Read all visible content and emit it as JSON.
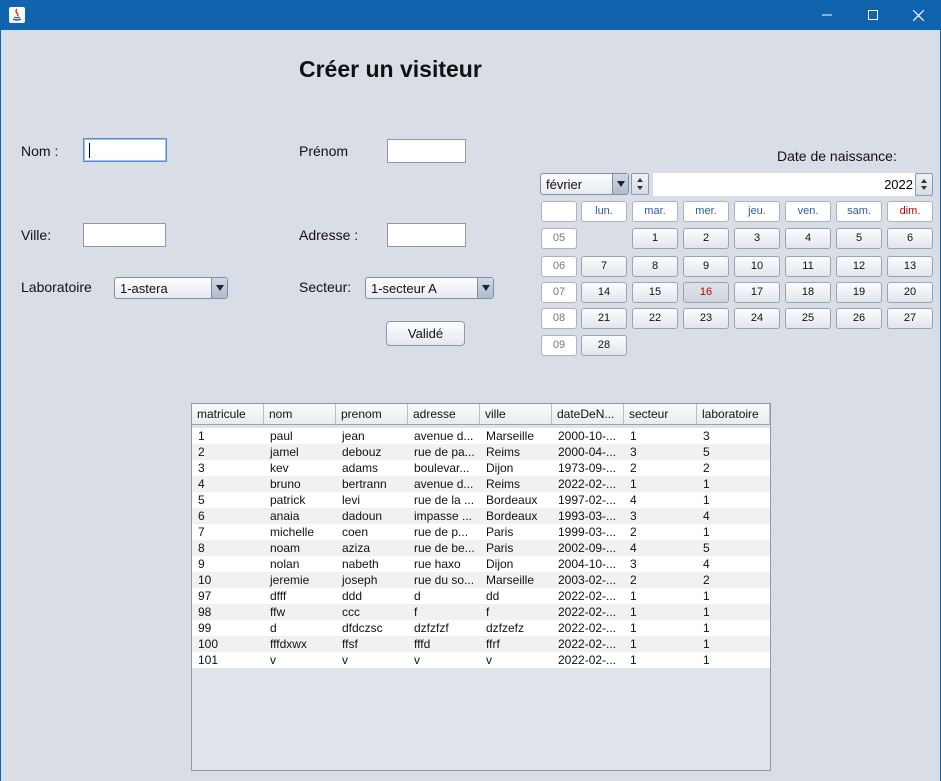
{
  "window": {
    "title": ""
  },
  "form": {
    "title": "Créer un visiteur",
    "nom_label": "Nom :",
    "prenom_label": "Prénom",
    "ville_label": "Ville:",
    "adresse_label": "Adresse :",
    "laboratoire_label": "Laboratoire",
    "laboratoire_value": "1-astera",
    "secteur_label": "Secteur:",
    "secteur_value": "1-secteur A",
    "valider_label": "Validé",
    "nom_value": "",
    "prenom_value": "",
    "ville_value": "",
    "adresse_value": ""
  },
  "calendar": {
    "label": "Date de naissance:",
    "month": "février",
    "year": "2022",
    "day_headers": [
      "lun.",
      "mar.",
      "mer.",
      "jeu.",
      "ven.",
      "sam.",
      "dim."
    ],
    "weeks": [
      {
        "week": "05",
        "days": [
          "",
          "1",
          "2",
          "3",
          "4",
          "5",
          "6"
        ]
      },
      {
        "week": "06",
        "days": [
          "7",
          "8",
          "9",
          "10",
          "11",
          "12",
          "13"
        ]
      },
      {
        "week": "07",
        "days": [
          "14",
          "15",
          "16",
          "17",
          "18",
          "19",
          "20"
        ]
      },
      {
        "week": "08",
        "days": [
          "21",
          "22",
          "23",
          "24",
          "25",
          "26",
          "27"
        ]
      },
      {
        "week": "09",
        "days": [
          "28",
          "",
          "",
          "",
          "",
          "",
          ""
        ]
      }
    ],
    "selected_day": "16",
    "colors": {
      "sunday": "#c00000",
      "selected": "#c00000",
      "header": "#2a5aa0"
    }
  },
  "table": {
    "columns": [
      "matricule",
      "nom",
      "prenom",
      "adresse",
      "ville",
      "dateDeN...",
      "secteur",
      "laboratoire"
    ],
    "rows": [
      [
        "1",
        "paul",
        "jean",
        "avenue d...",
        "Marseille",
        "2000-10-...",
        "1",
        "3"
      ],
      [
        "2",
        "jamel",
        "debouz",
        "rue de pa...",
        "Reims",
        "2000-04-...",
        "3",
        "5"
      ],
      [
        "3",
        "kev",
        "adams",
        "boulevar...",
        "Dijon",
        "1973-09-...",
        "2",
        "2"
      ],
      [
        "4",
        "bruno",
        "bertrann",
        "avenue d...",
        "Reims",
        "2022-02-...",
        "1",
        "1"
      ],
      [
        "5",
        "patrick",
        "levi",
        "rue de la ...",
        "Bordeaux",
        "1997-02-...",
        "4",
        "1"
      ],
      [
        "6",
        "anaia",
        "dadoun",
        " impasse ...",
        "Bordeaux",
        "1993-03-...",
        "3",
        "4"
      ],
      [
        "7",
        "michelle",
        "coen",
        " rue de p...",
        "Paris",
        "1999-03-...",
        "2",
        "1"
      ],
      [
        "8",
        "noam",
        "aziza",
        "rue de be...",
        "Paris",
        "2002-09-...",
        "4",
        "5"
      ],
      [
        "9",
        "nolan",
        "nabeth",
        "rue haxo",
        "Dijon",
        "2004-10-...",
        "3",
        "4"
      ],
      [
        "10",
        "jeremie",
        "joseph",
        "rue du so...",
        "Marseille",
        "2003-02-...",
        "2",
        "2"
      ],
      [
        "97",
        "dfff",
        "ddd",
        "d",
        "dd",
        "2022-02-...",
        "1",
        "1"
      ],
      [
        "98",
        "ffw",
        "ccc",
        "f",
        "f",
        "2022-02-...",
        "1",
        "1"
      ],
      [
        "99",
        "d",
        "dfdczsc",
        "dzfzfzf",
        "dzfzefz",
        "2022-02-...",
        "1",
        "1"
      ],
      [
        "100",
        "fffdxwx",
        "ffsf",
        "fffd",
        "ffrf",
        "2022-02-...",
        "1",
        "1"
      ],
      [
        "101",
        "v",
        "v",
        "v",
        "v",
        "2022-02-...",
        "1",
        "1"
      ]
    ]
  }
}
